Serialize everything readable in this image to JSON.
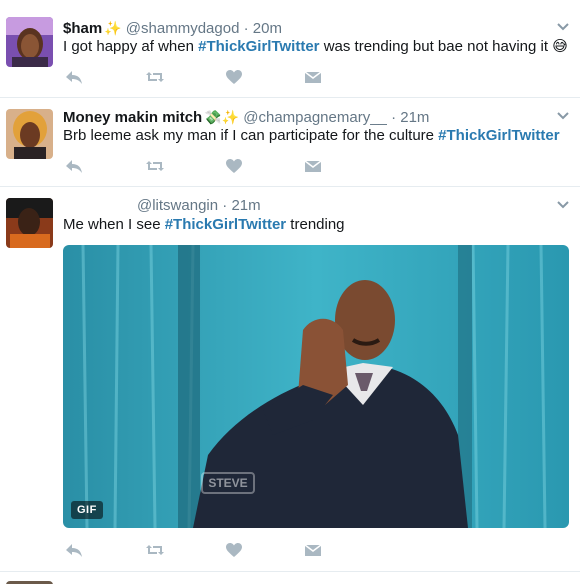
{
  "tweets": [
    {
      "name": "$ham",
      "name_emoji": "✨",
      "handle": "@shammydagod",
      "sep": "·",
      "time": "20m",
      "text_before": "I got happy af when ",
      "hashtag": "#ThickGirlTwitter",
      "text_after": " was trending but bae not having it ",
      "trailing_emoji": "😅"
    },
    {
      "name": "Money makin mitch",
      "name_emoji": "💸✨",
      "handle": "@champagnemary__",
      "sep": "·",
      "time": "21m",
      "text_before": "Brb leeme ask my man if I can participate for the culture ",
      "hashtag": "#ThickGirlTwitter",
      "text_after": ""
    },
    {
      "name": "",
      "handle": "@litswangin",
      "sep": "·",
      "time": "21m",
      "text_before": "Me when I see ",
      "hashtag": "#ThickGirlTwitter",
      "text_after": " trending",
      "media_badge": "GIF",
      "media_watermark": "STEVE"
    }
  ],
  "icons": {
    "reply": "reply-icon",
    "retweet": "retweet-icon",
    "like": "heart-icon",
    "dm": "envelope-icon",
    "more": "chevron-down-icon"
  },
  "colors": {
    "hashtag": "#2a7ab0",
    "icon": "#aab8c2",
    "meta": "#657786"
  }
}
